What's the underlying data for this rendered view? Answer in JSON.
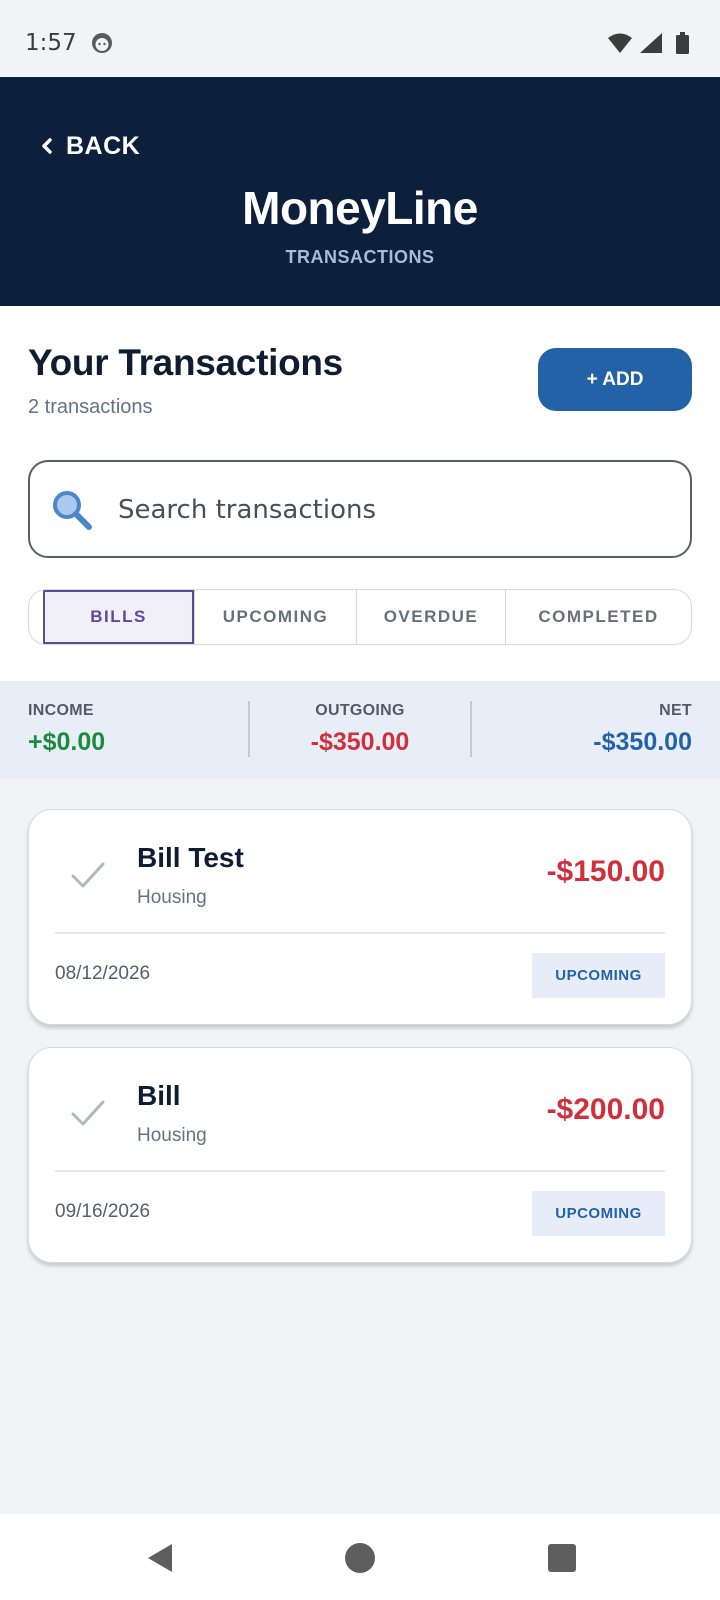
{
  "status_bar": {
    "time": "1:57",
    "icons": [
      "face-icon",
      "wifi-icon",
      "signal-icon",
      "battery-icon"
    ]
  },
  "header": {
    "back_label": "BACK",
    "title": "MoneyLine",
    "subtitle": "TRANSACTIONS",
    "background_color": "#0c1f3b"
  },
  "page": {
    "title": "Your Transactions",
    "count_label": "2 transactions",
    "add_label": "+ ADD",
    "search_placeholder": "Search transactions"
  },
  "tabs": [
    {
      "label": "BILLS",
      "active": true
    },
    {
      "label": "UPCOMING",
      "active": false
    },
    {
      "label": "OVERDUE",
      "active": false
    },
    {
      "label": "COMPLETED",
      "active": false
    }
  ],
  "summary": {
    "income": {
      "label": "INCOME",
      "value": "+$0.00",
      "color": "#1e8a3c"
    },
    "outgoing": {
      "label": "OUTGOING",
      "value": "-$350.00",
      "color": "#d0303c"
    },
    "net": {
      "label": "NET",
      "value": "-$350.00",
      "color": "#2362a7"
    }
  },
  "transactions": [
    {
      "name": "Bill Test",
      "category": "Housing",
      "amount": "-$150.00",
      "date": "08/12/2026",
      "status": "UPCOMING"
    },
    {
      "name": "Bill",
      "category": "Housing",
      "amount": "-$200.00",
      "date": "09/16/2026",
      "status": "UPCOMING"
    }
  ],
  "nav": [
    "back-icon",
    "home-icon",
    "recents-icon"
  ]
}
